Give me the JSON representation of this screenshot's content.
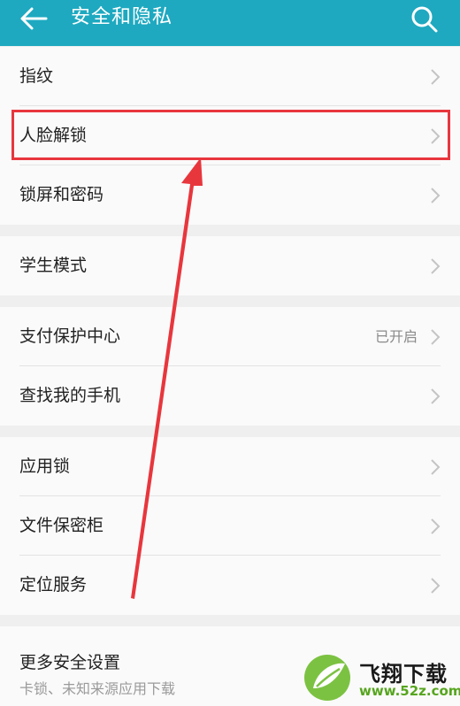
{
  "header": {
    "title": "安全和隐私",
    "back_icon": "arrow-left-icon",
    "search_icon": "search-icon"
  },
  "groups": [
    {
      "items": [
        {
          "label": "指纹"
        },
        {
          "label": "人脸解锁"
        },
        {
          "label": "锁屏和密码"
        }
      ]
    },
    {
      "items": [
        {
          "label": "学生模式"
        }
      ]
    },
    {
      "items": [
        {
          "label": "支付保护中心",
          "status": "已开启"
        },
        {
          "label": "查找我的手机"
        }
      ]
    },
    {
      "items": [
        {
          "label": "应用锁"
        },
        {
          "label": "文件保密柜"
        },
        {
          "label": "定位服务"
        }
      ]
    },
    {
      "items": [
        {
          "label": "更多安全设置",
          "subtitle": "卡锁、未知来源应用下载"
        }
      ]
    }
  ],
  "annotation": {
    "highlight_color": "#e8363d",
    "highlighted_item": "人脸解锁"
  },
  "watermark": {
    "brand": "飞翔下载",
    "url": "www.52z.com"
  },
  "colors": {
    "appbar": "#1ea9c0",
    "background": "#efefef",
    "row": "#fafafa"
  }
}
